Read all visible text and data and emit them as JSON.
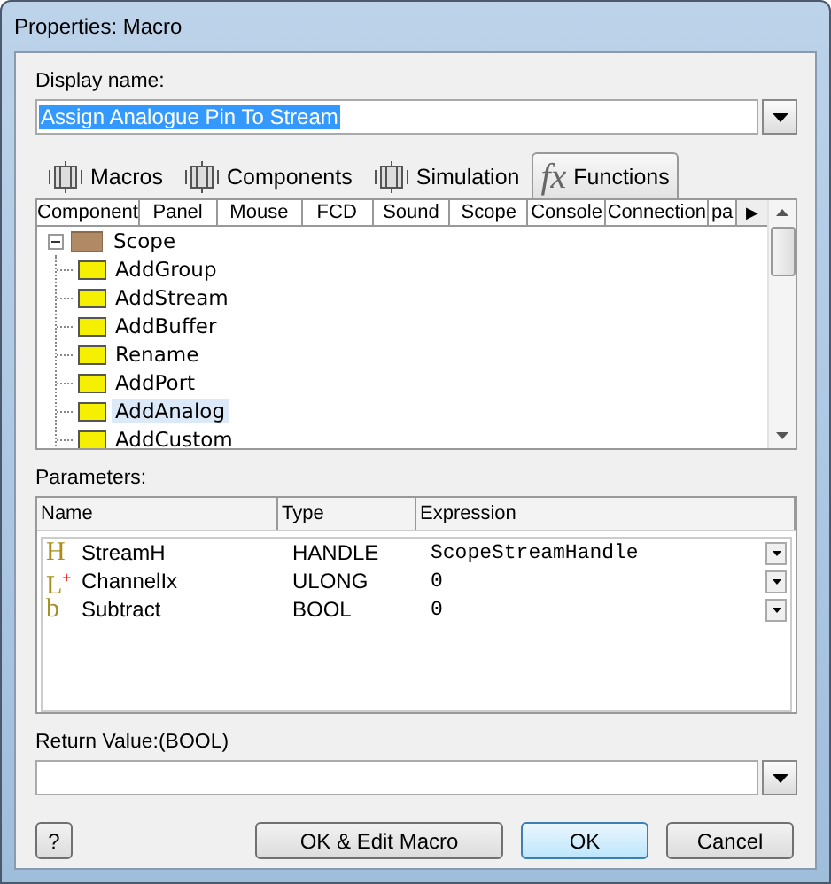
{
  "window": {
    "title": "Properties: Macro"
  },
  "display_name": {
    "label": "Display name:",
    "value": "Assign Analogue Pin To Stream",
    "selected": true
  },
  "tabs": [
    {
      "label": "Macros",
      "selected": false
    },
    {
      "label": "Components",
      "selected": false
    },
    {
      "label": "Simulation",
      "selected": false
    },
    {
      "label": "Functions",
      "icon_text": "fx",
      "selected": true
    }
  ],
  "category_tabs": [
    {
      "label": "Component",
      "selected": false
    },
    {
      "label": "Panel",
      "selected": false
    },
    {
      "label": "Mouse",
      "selected": false
    },
    {
      "label": "FCD",
      "selected": false
    },
    {
      "label": "Sound",
      "selected": false
    },
    {
      "label": "Scope",
      "selected": false
    },
    {
      "label": "Console",
      "selected": false
    },
    {
      "label": "Connection",
      "selected": false
    },
    {
      "label": "pa",
      "selected": false
    }
  ],
  "category_scroll": "▶",
  "tree": [
    {
      "label": "Scope",
      "expanded": true,
      "children": [
        {
          "label": "AddGroup",
          "selected": false
        },
        {
          "label": "AddStream",
          "selected": false
        },
        {
          "label": "AddBuffer",
          "selected": false
        },
        {
          "label": "Rename",
          "selected": false
        },
        {
          "label": "AddPort",
          "selected": false
        },
        {
          "label": "AddAnalog",
          "selected": true
        },
        {
          "label": "AddCustom",
          "selected": false
        }
      ]
    }
  ],
  "parameters": {
    "label": "Parameters:",
    "columns": [
      "Name",
      "Type",
      "Expression"
    ],
    "rows": [
      {
        "icon": "H",
        "name": "StreamH",
        "type": "HANDLE",
        "expression": "ScopeStreamHandle"
      },
      {
        "icon": "L$^{+}$",
        "name": "ChannelIx",
        "type": "ULONG",
        "expression": "0"
      },
      {
        "icon": "b",
        "name": "Subtract",
        "type": "BOOL",
        "expression": "0"
      }
    ]
  },
  "return_value": {
    "label": "Return Value:(BOOL)"
  },
  "buttons": {
    "help": "?",
    "edit": "OK & Edit Macro",
    "ok": "OK",
    "cancel": "Cancel"
  }
}
